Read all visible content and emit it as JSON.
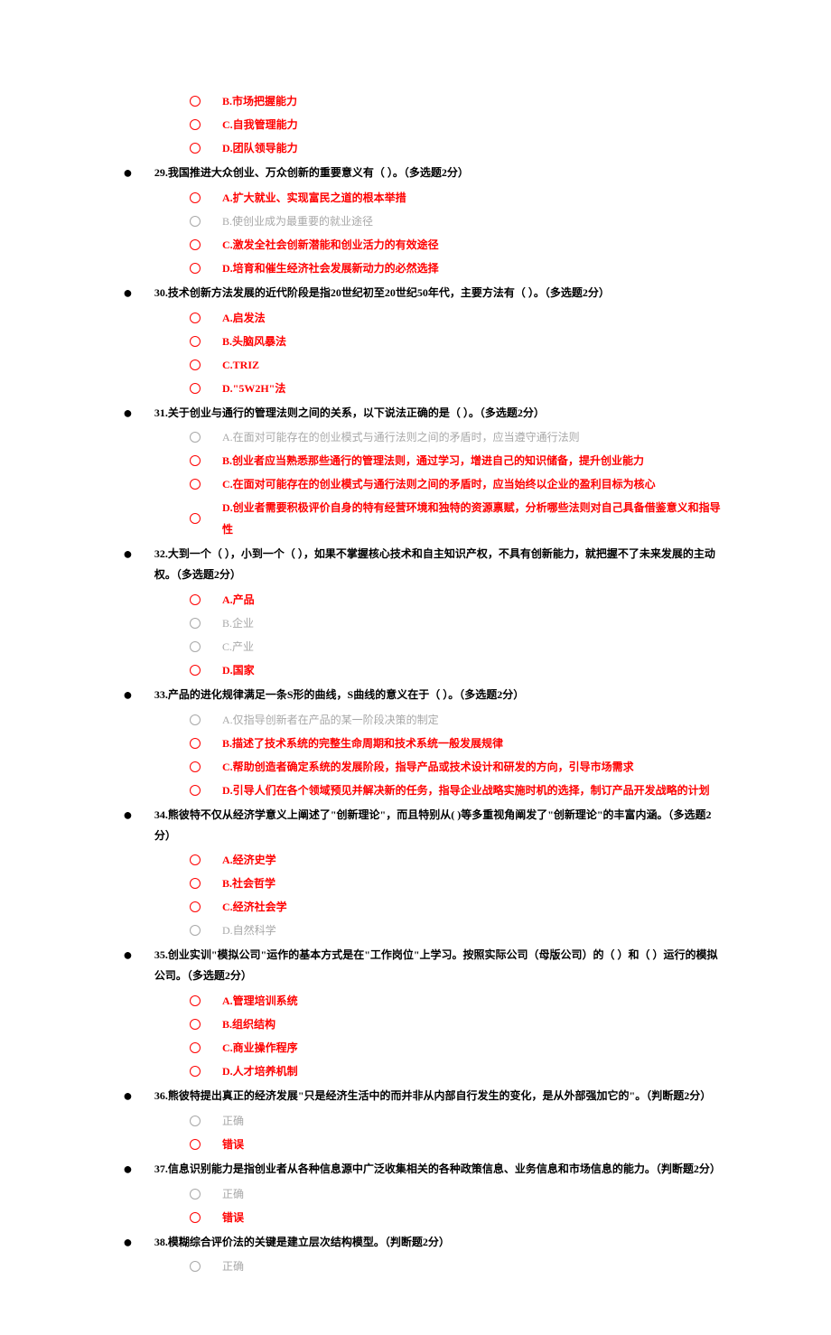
{
  "prepend_options": [
    {
      "label": "B.市场把握能力",
      "color": "red"
    },
    {
      "label": "C.自我管理能力",
      "color": "red"
    },
    {
      "label": "D.团队领导能力",
      "color": "red"
    }
  ],
  "questions": [
    {
      "num": "29",
      "text": "29.我国推进大众创业、万众创新的重要意义有（ ）。（多选题2分）",
      "options": [
        {
          "label": "A.扩大就业、实现富民之道的根本举措",
          "color": "red"
        },
        {
          "label": "B.使创业成为最重要的就业途径",
          "color": "gray"
        },
        {
          "label": "C.激发全社会创新潜能和创业活力的有效途径",
          "color": "red"
        },
        {
          "label": "D.培育和催生经济社会发展新动力的必然选择",
          "color": "red"
        }
      ]
    },
    {
      "num": "30",
      "text": "30.技术创新方法发展的近代阶段是指20世纪初至20世纪50年代，主要方法有（ ）。（多选题2分）",
      "options": [
        {
          "label": "A.启发法",
          "color": "red"
        },
        {
          "label": "B.头脑风暴法",
          "color": "red"
        },
        {
          "label": "C.TRIZ",
          "color": "red"
        },
        {
          "label": "D.\"5W2H\"法",
          "color": "red"
        }
      ]
    },
    {
      "num": "31",
      "text": "31.关于创业与通行的管理法则之间的关系，以下说法正确的是（ ）。（多选题2分）",
      "options": [
        {
          "label": "A.在面对可能存在的创业模式与通行法则之间的矛盾时，应当遵守通行法则",
          "color": "gray"
        },
        {
          "label": "B.创业者应当熟悉那些通行的管理法则，通过学习，增进自己的知识储备，提升创业能力",
          "color": "red"
        },
        {
          "label": "C.在面对可能存在的创业模式与通行法则之间的矛盾时，应当始终以企业的盈利目标为核心",
          "color": "red"
        },
        {
          "label": "D.创业者需要积极评价自身的特有经营环境和独特的资源禀赋，分析哪些法则对自己具备借鉴意义和指导性",
          "color": "red"
        }
      ]
    },
    {
      "num": "32",
      "text": "32.大到一个（ ），小到一个（ ），如果不掌握核心技术和自主知识产权，不具有创新能力，就把握不了未来发展的主动权。（多选题2分）",
      "options": [
        {
          "label": "A.产品",
          "color": "red"
        },
        {
          "label": "B.企业",
          "color": "gray"
        },
        {
          "label": "C.产业",
          "color": "gray"
        },
        {
          "label": "D.国家",
          "color": "red"
        }
      ]
    },
    {
      "num": "33",
      "text": "33.产品的进化规律满足一条S形的曲线，S曲线的意义在于（ ）。（多选题2分）",
      "options": [
        {
          "label": "A.仅指导创新者在产品的某一阶段决策的制定",
          "color": "gray"
        },
        {
          "label": "B.描述了技术系统的完整生命周期和技术系统一般发展规律",
          "color": "red"
        },
        {
          "label": "C.帮助创造者确定系统的发展阶段，指导产品或技术设计和研发的方向，引导市场需求",
          "color": "red"
        },
        {
          "label": "D.引导人们在各个领域预见并解决新的任务，指导企业战略实施时机的选择，制订产品开发战略的计划",
          "color": "red"
        }
      ]
    },
    {
      "num": "34",
      "text": "34.熊彼特不仅从经济学意义上阐述了\"创新理论\"，而且特别从( )等多重视角阐发了\"创新理论\"的丰富内涵。（多选题2分）",
      "options": [
        {
          "label": "A.经济史学",
          "color": "red"
        },
        {
          "label": "B.社会哲学",
          "color": "red"
        },
        {
          "label": "C.经济社会学",
          "color": "red"
        },
        {
          "label": "D.自然科学",
          "color": "gray"
        }
      ]
    },
    {
      "num": "35",
      "text": "35.创业实训\"模拟公司\"运作的基本方式是在\"工作岗位\"上学习。按照实际公司（母版公司）的（ ）和（ ）运行的模拟公司。（多选题2分）",
      "options": [
        {
          "label": "A.管理培训系统",
          "color": "red"
        },
        {
          "label": "B.组织结构",
          "color": "red"
        },
        {
          "label": "C.商业操作程序",
          "color": "red"
        },
        {
          "label": "D.人才培养机制",
          "color": "red"
        }
      ]
    },
    {
      "num": "36",
      "text": "36.熊彼特提出真正的经济发展\"只是经济生活中的而并非从内部自行发生的变化，是从外部强加它的\"。（判断题2分）",
      "options": [
        {
          "label": "正确",
          "color": "gray"
        },
        {
          "label": "错误",
          "color": "red"
        }
      ]
    },
    {
      "num": "37",
      "text": "37.信息识别能力是指创业者从各种信息源中广泛收集相关的各种政策信息、业务信息和市场信息的能力。（判断题2分）",
      "options": [
        {
          "label": "正确",
          "color": "gray"
        },
        {
          "label": "错误",
          "color": "red"
        }
      ]
    },
    {
      "num": "38",
      "text": "38.模糊综合评价法的关键是建立层次结构模型。（判断题2分）",
      "options": [
        {
          "label": "正确",
          "color": "gray"
        }
      ]
    }
  ]
}
